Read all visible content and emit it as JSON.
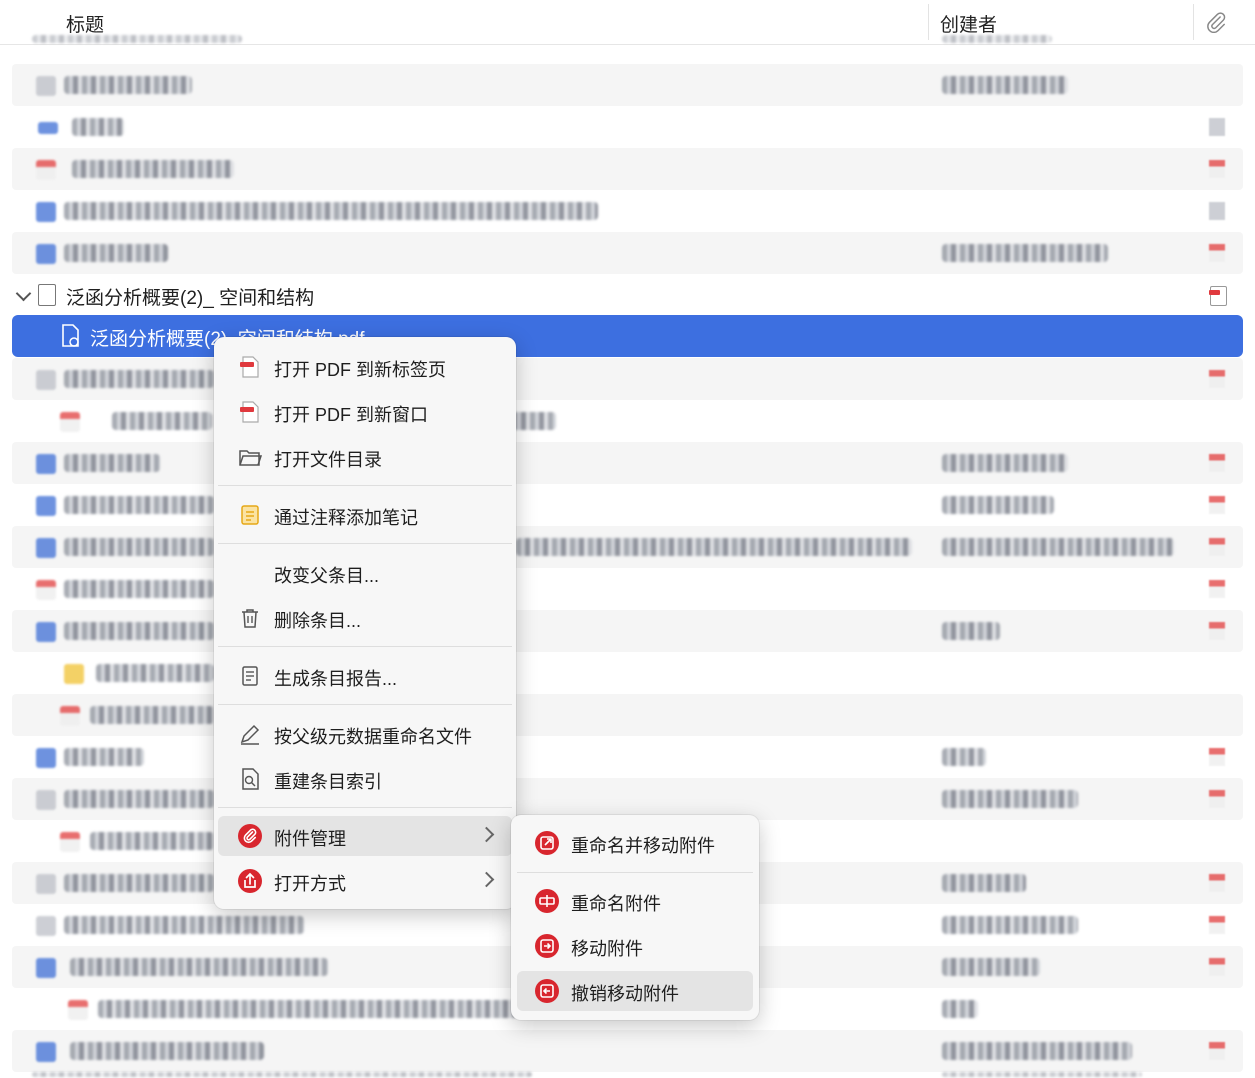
{
  "header": {
    "title_col": "标题",
    "creator_col": "创建者",
    "attachment_icon": "paperclip-icon"
  },
  "parent_item": {
    "title": "泛函分析概要(2)_ 空间和结构",
    "icon": "document-icon"
  },
  "selected_item": {
    "title": "泛函分析概要(2)_空间和结构.pdf",
    "icon": "pdf-attachment-icon"
  },
  "context_menu": {
    "items": [
      {
        "label": "打开 PDF 到新标签页",
        "icon": "pdf-icon"
      },
      {
        "label": "打开 PDF 到新窗口",
        "icon": "pdf-icon"
      },
      {
        "label": "打开文件目录",
        "icon": "folder-icon"
      },
      {
        "label": "通过注释添加笔记",
        "icon": "note-icon"
      },
      {
        "label": "改变父条目...",
        "icon": ""
      },
      {
        "label": "删除条目...",
        "icon": "trash-icon"
      },
      {
        "label": "生成条目报告...",
        "icon": "report-icon"
      },
      {
        "label": "按父级元数据重命名文件",
        "icon": "pencil-icon"
      },
      {
        "label": "重建条目索引",
        "icon": "reindex-icon"
      },
      {
        "label": "附件管理",
        "icon": "attachment-manager-icon"
      },
      {
        "label": "打开方式",
        "icon": "open-with-icon"
      }
    ]
  },
  "submenu": {
    "items": [
      {
        "label": "重命名并移动附件",
        "icon": "rename-move-icon"
      },
      {
        "label": "重命名附件",
        "icon": "rename-icon"
      },
      {
        "label": "移动附件",
        "icon": "move-icon"
      },
      {
        "label": "撤销移动附件",
        "icon": "undo-move-icon"
      }
    ]
  },
  "colors": {
    "selection": "#3d6fe0",
    "accent_red": "#d8262e"
  }
}
